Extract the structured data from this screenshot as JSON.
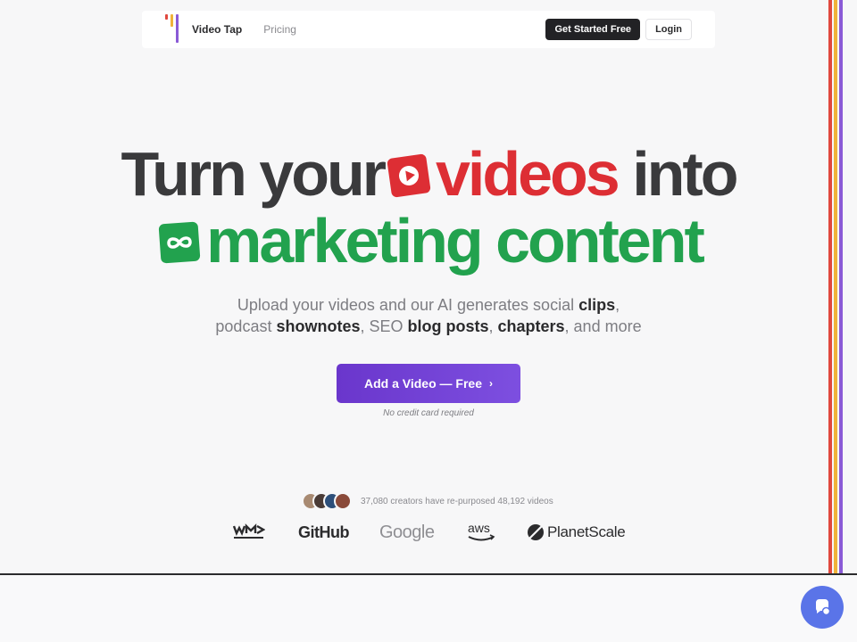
{
  "nav": {
    "brand": "Video Tap",
    "pricing": "Pricing",
    "get_started": "Get Started Free",
    "login": "Login"
  },
  "hero": {
    "line1_pre": "Turn your",
    "line1_red": "videos",
    "line1_post": "into",
    "line2": "marketing content",
    "sub1_pre": "Upload your videos and our AI generates social ",
    "sub1_clips": "clips",
    "sub1_comma": ",",
    "sub2_pre": "podcast ",
    "sub2_shownotes": "shownotes",
    "sub2_mid1": ", SEO ",
    "sub2_blog": "blog posts",
    "sub2_mid2": ", ",
    "sub2_chapters": "chapters",
    "sub2_end": ", and more",
    "cta": "Add a Video — Free",
    "cta_chevron": "›",
    "no_card": "No credit card required"
  },
  "proof": {
    "text": "37,080 creators have re-purposed 48,192 videos"
  },
  "logos": {
    "github": "GitHub",
    "google": "Google",
    "planetscale": "PlanetScale"
  },
  "icons": {
    "youtube": "play-icon",
    "infinity": "infinity-icon",
    "chat": "chat-icon"
  },
  "colors": {
    "red": "#dd2e34",
    "green": "#22a24e",
    "purple": "#6a36cc",
    "chat": "#5a74e8"
  }
}
